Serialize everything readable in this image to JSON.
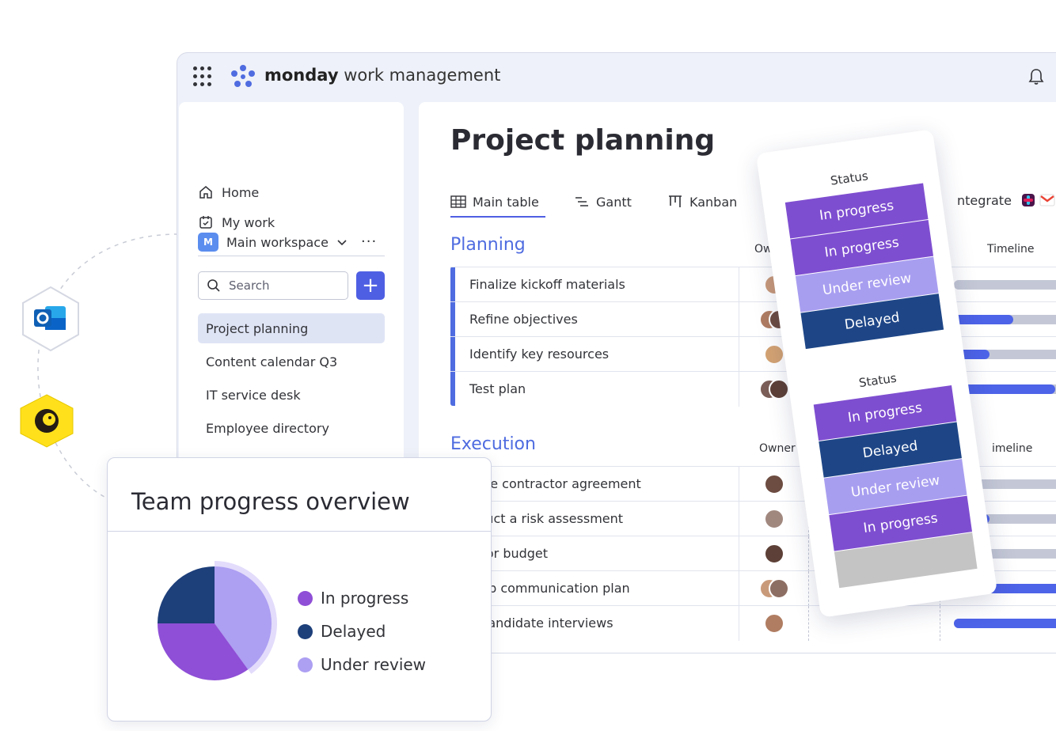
{
  "app": {
    "brand_bold": "monday",
    "brand_rest": " work management",
    "icons": {
      "apps": "apps-grid-icon",
      "logo": "monday-logo-icon",
      "bell": "bell-icon"
    }
  },
  "sidebar": {
    "nav": [
      {
        "label": "Home",
        "icon": "home-icon"
      },
      {
        "label": "My work",
        "icon": "calendar-check-icon"
      }
    ],
    "workspace": {
      "badge": "M",
      "name": "Main workspace",
      "badge_color": "#5b8def"
    },
    "search_placeholder": "Search",
    "add_label": "+",
    "boards": [
      {
        "label": "Project planning",
        "active": true
      },
      {
        "label": "Content calendar Q3",
        "active": false
      },
      {
        "label": "IT service desk",
        "active": false
      },
      {
        "label": "Employee directory",
        "active": false
      }
    ]
  },
  "board": {
    "title": "Project planning",
    "tabs": [
      {
        "label": "Main table",
        "icon": "table-icon"
      },
      {
        "label": "Gantt",
        "icon": "gantt-icon"
      },
      {
        "label": "Kanban",
        "icon": "kanban-icon"
      }
    ],
    "add_tab": "+",
    "integrate_label": "ntegrate",
    "groups": [
      {
        "title": "Planning",
        "color": "#4f6ce0",
        "owner_header": "Owner",
        "timeline_header": "Timeline",
        "rows": [
          {
            "name": "Finalize kickoff materials",
            "timeline_progress": 0.0
          },
          {
            "name": "Refine objectives",
            "timeline_progress": 0.5
          },
          {
            "name": "Identify key resources",
            "timeline_progress": 0.3
          },
          {
            "name": "Test plan",
            "timeline_progress": 0.85
          }
        ]
      },
      {
        "title": "Execution",
        "color": "#4f6ce0",
        "owner_header": "Owner",
        "timeline_header": "imeline",
        "rows": [
          {
            "name": "date contractor agreement",
            "timeline_progress": 0.0
          },
          {
            "name": "nduct a risk assessment",
            "timeline_progress": 0.3
          },
          {
            "name": "nitor budget",
            "timeline_progress": 0.0
          },
          {
            "name": "elop communication plan",
            "timeline_progress": 0.9
          },
          {
            "name": "v candidate interviews",
            "timeline_progress": 1.0
          }
        ]
      }
    ]
  },
  "status_popover": {
    "sections": [
      {
        "header": "Status",
        "cells": [
          {
            "label": "In progress",
            "color": "#7e4ed0"
          },
          {
            "label": "In progress",
            "color": "#7e4ed0"
          },
          {
            "label": "Under review",
            "color": "#a89ef0"
          },
          {
            "label": "Delayed",
            "color": "#1e4687"
          }
        ]
      },
      {
        "header": "Status",
        "cells": [
          {
            "label": "In progress",
            "color": "#7e4ed0"
          },
          {
            "label": "Delayed",
            "color": "#1e4687"
          },
          {
            "label": "Under review",
            "color": "#a89ef0"
          },
          {
            "label": "In progress",
            "color": "#7e4ed0"
          },
          {
            "label": "",
            "color": "#c4c4c4"
          }
        ]
      }
    ]
  },
  "team_progress": {
    "title": "Team progress overview",
    "legend": [
      {
        "label": "In progress",
        "color": "#8f4fd6"
      },
      {
        "label": "Delayed",
        "color": "#1d3f7a"
      },
      {
        "label": "Under review",
        "color": "#ad9ff2"
      }
    ]
  },
  "chart_data": {
    "type": "pie",
    "title": "Team progress overview",
    "slices": [
      {
        "label": "Under review",
        "value": 40,
        "color": "#ad9ff2"
      },
      {
        "label": "In progress",
        "value": 35,
        "color": "#8f4fd6"
      },
      {
        "label": "Delayed",
        "value": 25,
        "color": "#1d3f7a"
      }
    ]
  },
  "integrations": [
    {
      "name": "outlook-icon",
      "color": "#0a64c8"
    },
    {
      "name": "mailchimp-icon",
      "color": "#ffe01b"
    }
  ]
}
